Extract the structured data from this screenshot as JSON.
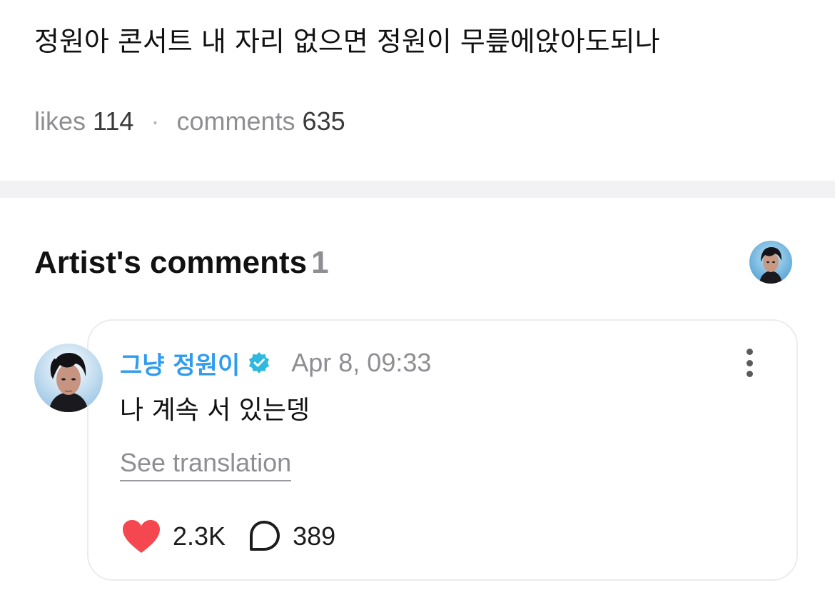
{
  "post": {
    "text": "정원아 콘서트 내 자리 없으면 정원이 무릎에앉아도되나",
    "likes_label": "likes",
    "likes_count": "114",
    "comments_label": "comments",
    "comments_count": "635"
  },
  "artist_comments": {
    "title": "Artist's comments",
    "count": "1",
    "header_avatar_icon": "artist-avatar"
  },
  "comment": {
    "author": "그냥 정원이",
    "verified_icon": "verified-badge-icon",
    "timestamp": "Apr 8, 09:33",
    "text": "나 계속 서 있는뎅",
    "translate_label": "See translation",
    "like_count": "2.3K",
    "reply_count": "389",
    "more_icon": "more-vertical-icon"
  },
  "colors": {
    "author_name": "#2f9cf0",
    "verified_badge": "#2fb8e0",
    "heart": "#f5474f",
    "muted_text": "#8e8e93",
    "divider": "#f2f2f4",
    "card_border": "#ececf0"
  }
}
